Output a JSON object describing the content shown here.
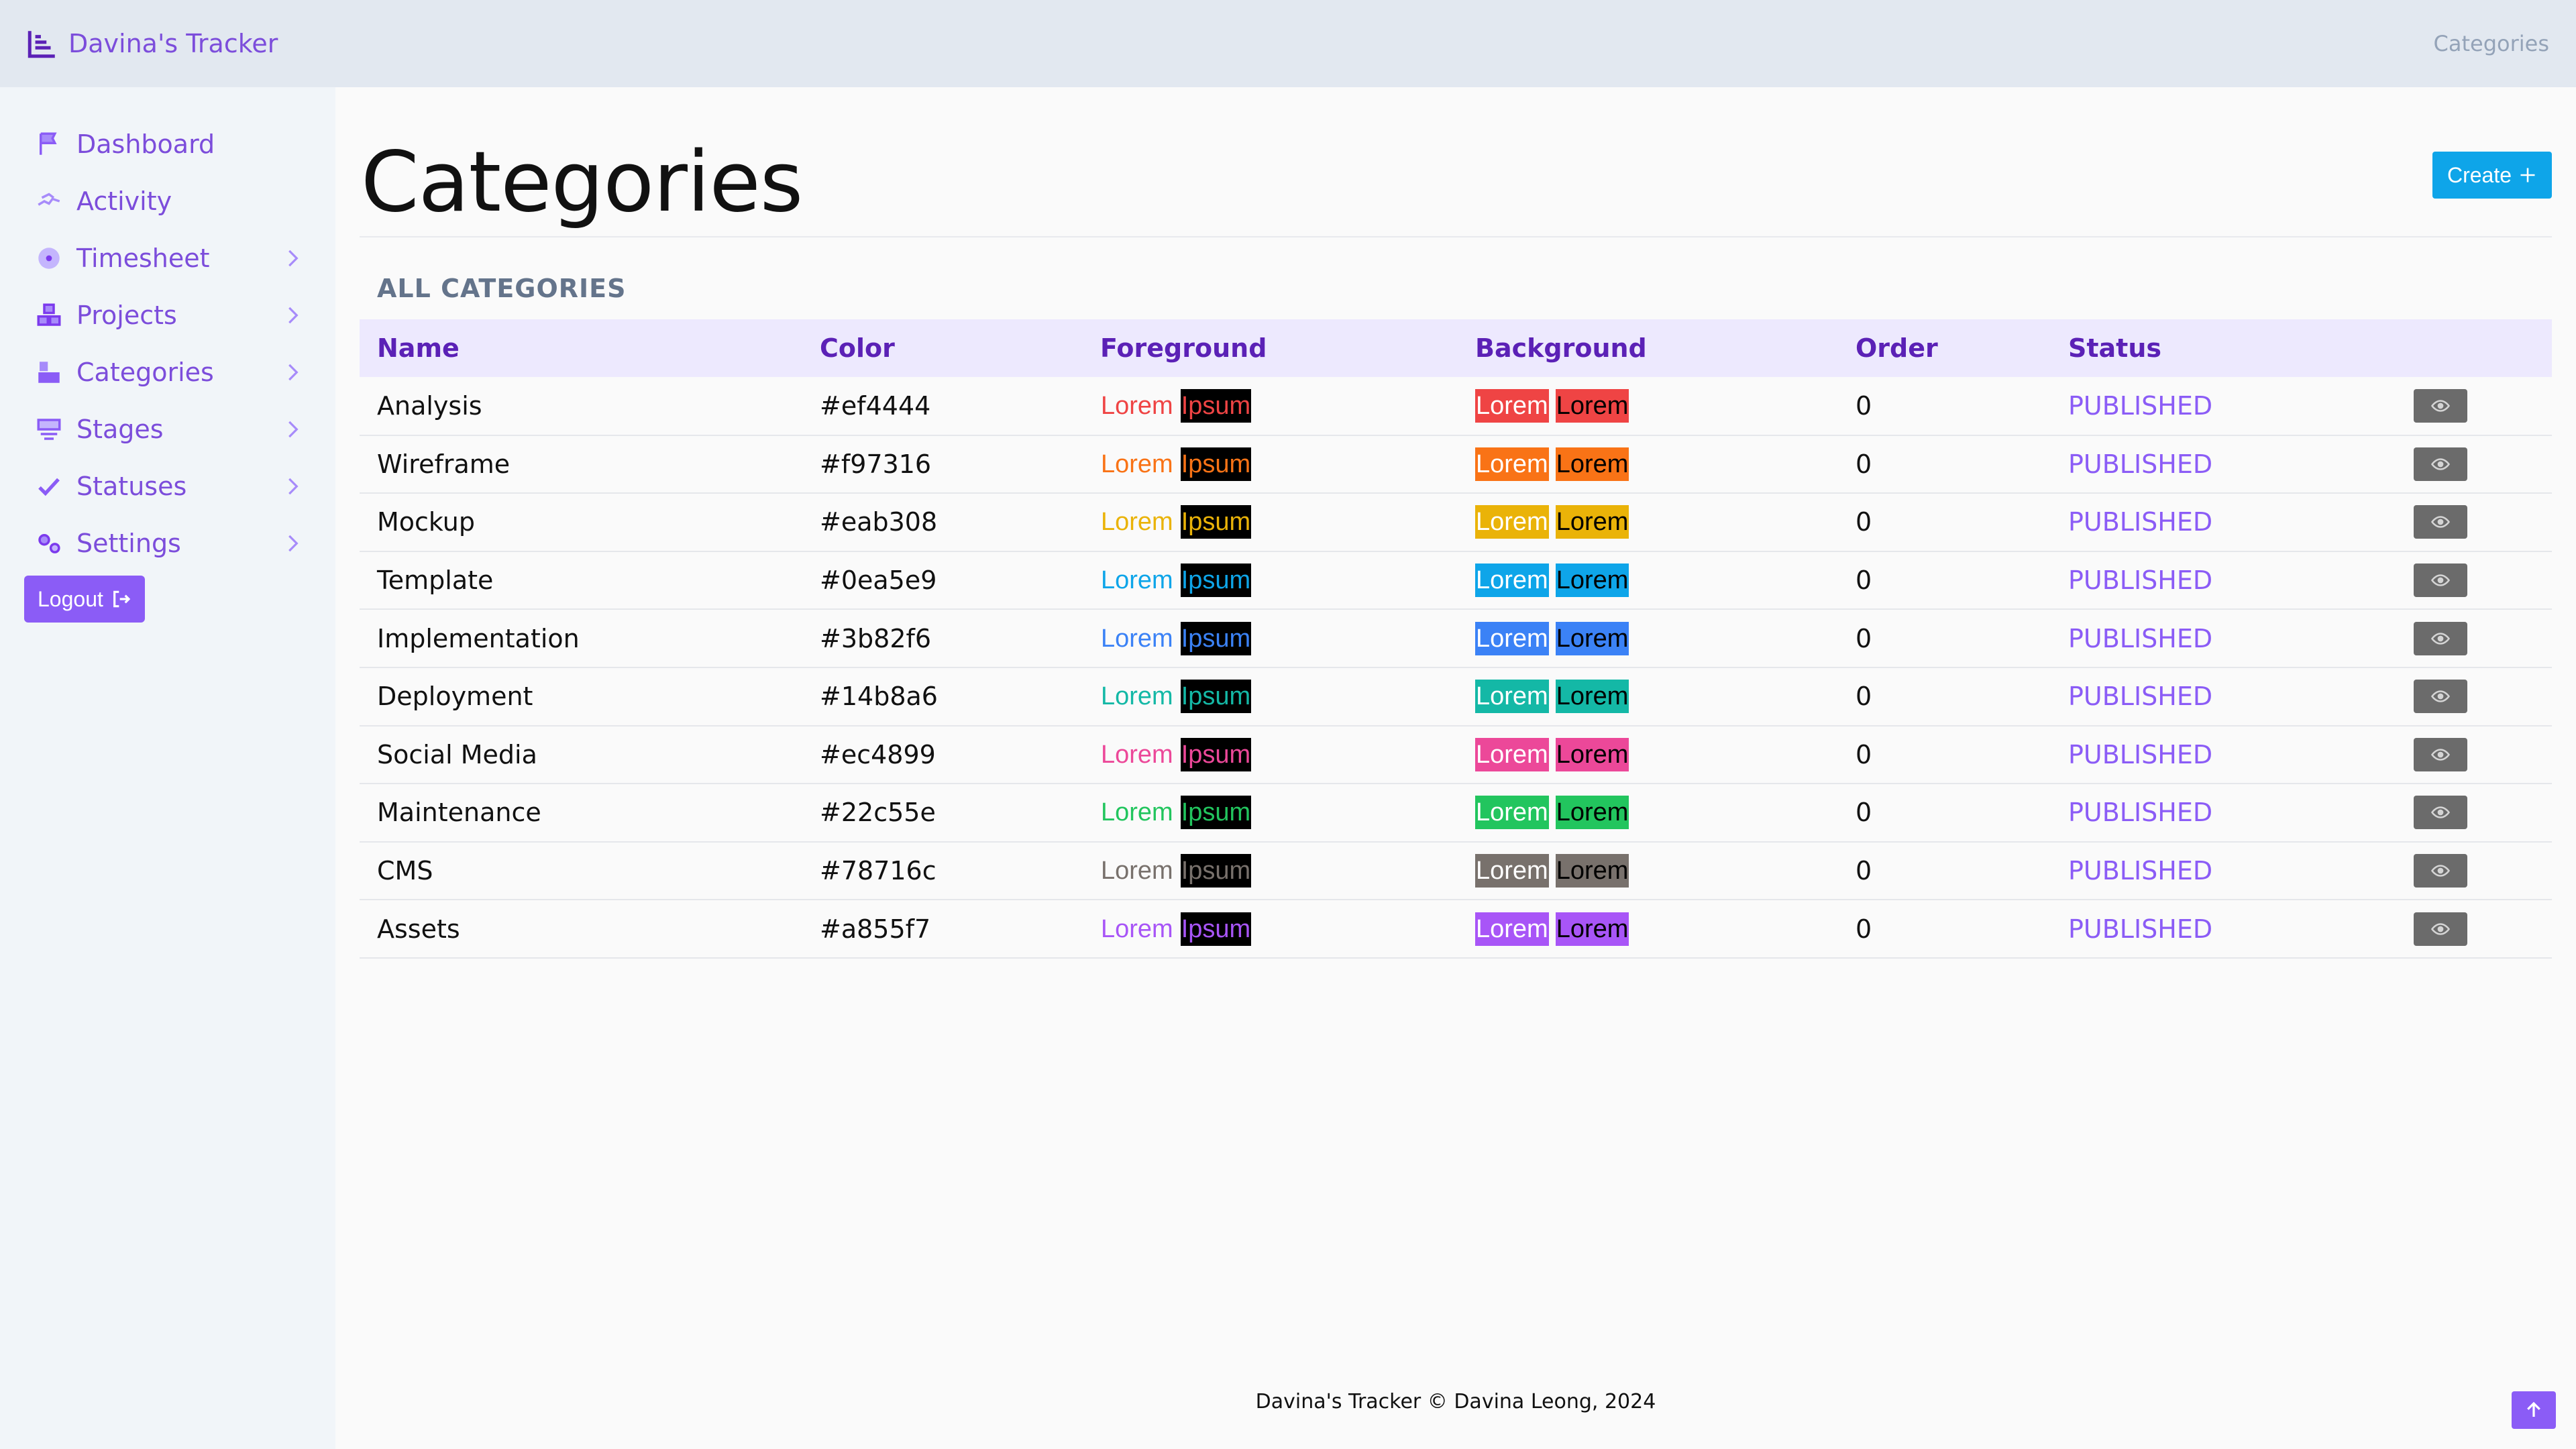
{
  "app": {
    "brand": "Davina's Tracker",
    "breadcrumb": "Categories"
  },
  "sidebar": {
    "items": [
      {
        "label": "Dashboard",
        "icon": "flag-icon",
        "expandable": false
      },
      {
        "label": "Activity",
        "icon": "running-icon",
        "expandable": false
      },
      {
        "label": "Timesheet",
        "icon": "disc-icon",
        "expandable": true
      },
      {
        "label": "Projects",
        "icon": "cubes-icon",
        "expandable": true
      },
      {
        "label": "Categories",
        "icon": "boxes-icon",
        "expandable": true
      },
      {
        "label": "Stages",
        "icon": "stage-icon",
        "expandable": true
      },
      {
        "label": "Statuses",
        "icon": "check-icon",
        "expandable": true
      },
      {
        "label": "Settings",
        "icon": "gears-icon",
        "expandable": true
      }
    ],
    "logout_label": "Logout"
  },
  "page": {
    "title": "Categories",
    "create_label": "Create",
    "section_label": "ALL CATEGORIES"
  },
  "table": {
    "headers": [
      "Name",
      "Color",
      "Foreground",
      "Background",
      "Order",
      "Status"
    ],
    "rows": [
      {
        "name": "Analysis",
        "color": "#ef4444",
        "fg1": "Lorem",
        "fg2": "Ipsum",
        "bg1": "Lorem",
        "bg2": "Lorem",
        "order": "0",
        "status": "PUBLISHED"
      },
      {
        "name": "Wireframe",
        "color": "#f97316",
        "fg1": "Lorem",
        "fg2": "Ipsum",
        "bg1": "Lorem",
        "bg2": "Lorem",
        "order": "0",
        "status": "PUBLISHED"
      },
      {
        "name": "Mockup",
        "color": "#eab308",
        "fg1": "Lorem",
        "fg2": "Ipsum",
        "bg1": "Lorem",
        "bg2": "Lorem",
        "order": "0",
        "status": "PUBLISHED"
      },
      {
        "name": "Template",
        "color": "#0ea5e9",
        "fg1": "Lorem",
        "fg2": "Ipsum",
        "bg1": "Lorem",
        "bg2": "Lorem",
        "order": "0",
        "status": "PUBLISHED"
      },
      {
        "name": "Implementation",
        "color": "#3b82f6",
        "fg1": "Lorem",
        "fg2": "Ipsum",
        "bg1": "Lorem",
        "bg2": "Lorem",
        "order": "0",
        "status": "PUBLISHED"
      },
      {
        "name": "Deployment",
        "color": "#14b8a6",
        "fg1": "Lorem",
        "fg2": "Ipsum",
        "bg1": "Lorem",
        "bg2": "Lorem",
        "order": "0",
        "status": "PUBLISHED"
      },
      {
        "name": "Social Media",
        "color": "#ec4899",
        "fg1": "Lorem",
        "fg2": "Ipsum",
        "bg1": "Lorem",
        "bg2": "Lorem",
        "order": "0",
        "status": "PUBLISHED"
      },
      {
        "name": "Maintenance",
        "color": "#22c55e",
        "fg1": "Lorem",
        "fg2": "Ipsum",
        "bg1": "Lorem",
        "bg2": "Lorem",
        "order": "0",
        "status": "PUBLISHED"
      },
      {
        "name": "CMS",
        "color": "#78716c",
        "fg1": "Lorem",
        "fg2": "Ipsum",
        "bg1": "Lorem",
        "bg2": "Lorem",
        "order": "0",
        "status": "PUBLISHED"
      },
      {
        "name": "Assets",
        "color": "#a855f7",
        "fg1": "Lorem",
        "fg2": "Ipsum",
        "bg1": "Lorem",
        "bg2": "Lorem",
        "order": "0",
        "status": "PUBLISHED"
      }
    ],
    "row_action_icon": "eye-icon"
  },
  "footer": {
    "text": "Davina's Tracker © Davina Leong, 2024"
  },
  "scroll_top_icon": "arrow-up-icon",
  "colors": {
    "accent": "#8b5cf6",
    "create": "#0ea5e9",
    "header_bg": "#ede9fe",
    "topbar": "#e2e8f0"
  }
}
